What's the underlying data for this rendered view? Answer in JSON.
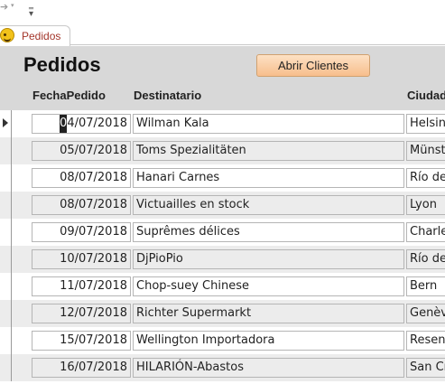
{
  "qat": {
    "undo_icon": "undo-arrow-icon",
    "customize_icon": "customize-qat-icon"
  },
  "tab": {
    "label": "Pedidos",
    "icon": "form-smiley-icon"
  },
  "header": {
    "title": "Pedidos",
    "button_label": "Abrir Clientes",
    "columns": [
      "FechaPedido",
      "Destinatario",
      "Ciudad"
    ]
  },
  "rows": [
    {
      "date_cursor": "0",
      "date_rest": "4/07/2018",
      "dest": "Wilman Kala",
      "city": "Helsinki"
    },
    {
      "date": "05/07/2018",
      "dest": "Toms Spezialitäten",
      "city": "Münster"
    },
    {
      "date": "08/07/2018",
      "dest": "Hanari Carnes",
      "city": "Río de Janeiro"
    },
    {
      "date": "08/07/2018",
      "dest": "Victuailles en stock",
      "city": "Lyon"
    },
    {
      "date": "09/07/2018",
      "dest": "Suprêmes délices",
      "city": "Charleroi"
    },
    {
      "date": "10/07/2018",
      "dest": "DjPioPio",
      "city": "Río de Janeiro"
    },
    {
      "date": "11/07/2018",
      "dest": "Chop-suey Chinese",
      "city": "Bern"
    },
    {
      "date": "12/07/2018",
      "dest": "Richter Supermarkt",
      "city": "Genève"
    },
    {
      "date": "15/07/2018",
      "dest": "Wellington Importadora",
      "city": "Resende"
    },
    {
      "date": "16/07/2018",
      "dest": "HILARIÓN-Abastos",
      "city": "San Cristóbal"
    }
  ],
  "colors": {
    "header_bg": "#d8d8d8",
    "button_bg": "#f7be8c",
    "tab_text": "#a3352a",
    "alt_row": "#ececec"
  }
}
